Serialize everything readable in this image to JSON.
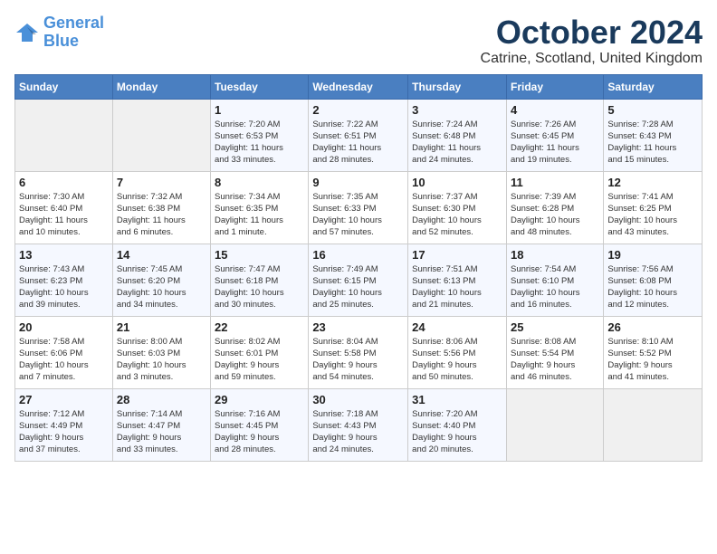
{
  "logo": {
    "line1": "General",
    "line2": "Blue"
  },
  "title": "October 2024",
  "location": "Catrine, Scotland, United Kingdom",
  "weekdays": [
    "Sunday",
    "Monday",
    "Tuesday",
    "Wednesday",
    "Thursday",
    "Friday",
    "Saturday"
  ],
  "weeks": [
    [
      {
        "day": "",
        "info": ""
      },
      {
        "day": "",
        "info": ""
      },
      {
        "day": "1",
        "info": "Sunrise: 7:20 AM\nSunset: 6:53 PM\nDaylight: 11 hours\nand 33 minutes."
      },
      {
        "day": "2",
        "info": "Sunrise: 7:22 AM\nSunset: 6:51 PM\nDaylight: 11 hours\nand 28 minutes."
      },
      {
        "day": "3",
        "info": "Sunrise: 7:24 AM\nSunset: 6:48 PM\nDaylight: 11 hours\nand 24 minutes."
      },
      {
        "day": "4",
        "info": "Sunrise: 7:26 AM\nSunset: 6:45 PM\nDaylight: 11 hours\nand 19 minutes."
      },
      {
        "day": "5",
        "info": "Sunrise: 7:28 AM\nSunset: 6:43 PM\nDaylight: 11 hours\nand 15 minutes."
      }
    ],
    [
      {
        "day": "6",
        "info": "Sunrise: 7:30 AM\nSunset: 6:40 PM\nDaylight: 11 hours\nand 10 minutes."
      },
      {
        "day": "7",
        "info": "Sunrise: 7:32 AM\nSunset: 6:38 PM\nDaylight: 11 hours\nand 6 minutes."
      },
      {
        "day": "8",
        "info": "Sunrise: 7:34 AM\nSunset: 6:35 PM\nDaylight: 11 hours\nand 1 minute."
      },
      {
        "day": "9",
        "info": "Sunrise: 7:35 AM\nSunset: 6:33 PM\nDaylight: 10 hours\nand 57 minutes."
      },
      {
        "day": "10",
        "info": "Sunrise: 7:37 AM\nSunset: 6:30 PM\nDaylight: 10 hours\nand 52 minutes."
      },
      {
        "day": "11",
        "info": "Sunrise: 7:39 AM\nSunset: 6:28 PM\nDaylight: 10 hours\nand 48 minutes."
      },
      {
        "day": "12",
        "info": "Sunrise: 7:41 AM\nSunset: 6:25 PM\nDaylight: 10 hours\nand 43 minutes."
      }
    ],
    [
      {
        "day": "13",
        "info": "Sunrise: 7:43 AM\nSunset: 6:23 PM\nDaylight: 10 hours\nand 39 minutes."
      },
      {
        "day": "14",
        "info": "Sunrise: 7:45 AM\nSunset: 6:20 PM\nDaylight: 10 hours\nand 34 minutes."
      },
      {
        "day": "15",
        "info": "Sunrise: 7:47 AM\nSunset: 6:18 PM\nDaylight: 10 hours\nand 30 minutes."
      },
      {
        "day": "16",
        "info": "Sunrise: 7:49 AM\nSunset: 6:15 PM\nDaylight: 10 hours\nand 25 minutes."
      },
      {
        "day": "17",
        "info": "Sunrise: 7:51 AM\nSunset: 6:13 PM\nDaylight: 10 hours\nand 21 minutes."
      },
      {
        "day": "18",
        "info": "Sunrise: 7:54 AM\nSunset: 6:10 PM\nDaylight: 10 hours\nand 16 minutes."
      },
      {
        "day": "19",
        "info": "Sunrise: 7:56 AM\nSunset: 6:08 PM\nDaylight: 10 hours\nand 12 minutes."
      }
    ],
    [
      {
        "day": "20",
        "info": "Sunrise: 7:58 AM\nSunset: 6:06 PM\nDaylight: 10 hours\nand 7 minutes."
      },
      {
        "day": "21",
        "info": "Sunrise: 8:00 AM\nSunset: 6:03 PM\nDaylight: 10 hours\nand 3 minutes."
      },
      {
        "day": "22",
        "info": "Sunrise: 8:02 AM\nSunset: 6:01 PM\nDaylight: 9 hours\nand 59 minutes."
      },
      {
        "day": "23",
        "info": "Sunrise: 8:04 AM\nSunset: 5:58 PM\nDaylight: 9 hours\nand 54 minutes."
      },
      {
        "day": "24",
        "info": "Sunrise: 8:06 AM\nSunset: 5:56 PM\nDaylight: 9 hours\nand 50 minutes."
      },
      {
        "day": "25",
        "info": "Sunrise: 8:08 AM\nSunset: 5:54 PM\nDaylight: 9 hours\nand 46 minutes."
      },
      {
        "day": "26",
        "info": "Sunrise: 8:10 AM\nSunset: 5:52 PM\nDaylight: 9 hours\nand 41 minutes."
      }
    ],
    [
      {
        "day": "27",
        "info": "Sunrise: 7:12 AM\nSunset: 4:49 PM\nDaylight: 9 hours\nand 37 minutes."
      },
      {
        "day": "28",
        "info": "Sunrise: 7:14 AM\nSunset: 4:47 PM\nDaylight: 9 hours\nand 33 minutes."
      },
      {
        "day": "29",
        "info": "Sunrise: 7:16 AM\nSunset: 4:45 PM\nDaylight: 9 hours\nand 28 minutes."
      },
      {
        "day": "30",
        "info": "Sunrise: 7:18 AM\nSunset: 4:43 PM\nDaylight: 9 hours\nand 24 minutes."
      },
      {
        "day": "31",
        "info": "Sunrise: 7:20 AM\nSunset: 4:40 PM\nDaylight: 9 hours\nand 20 minutes."
      },
      {
        "day": "",
        "info": ""
      },
      {
        "day": "",
        "info": ""
      }
    ]
  ]
}
